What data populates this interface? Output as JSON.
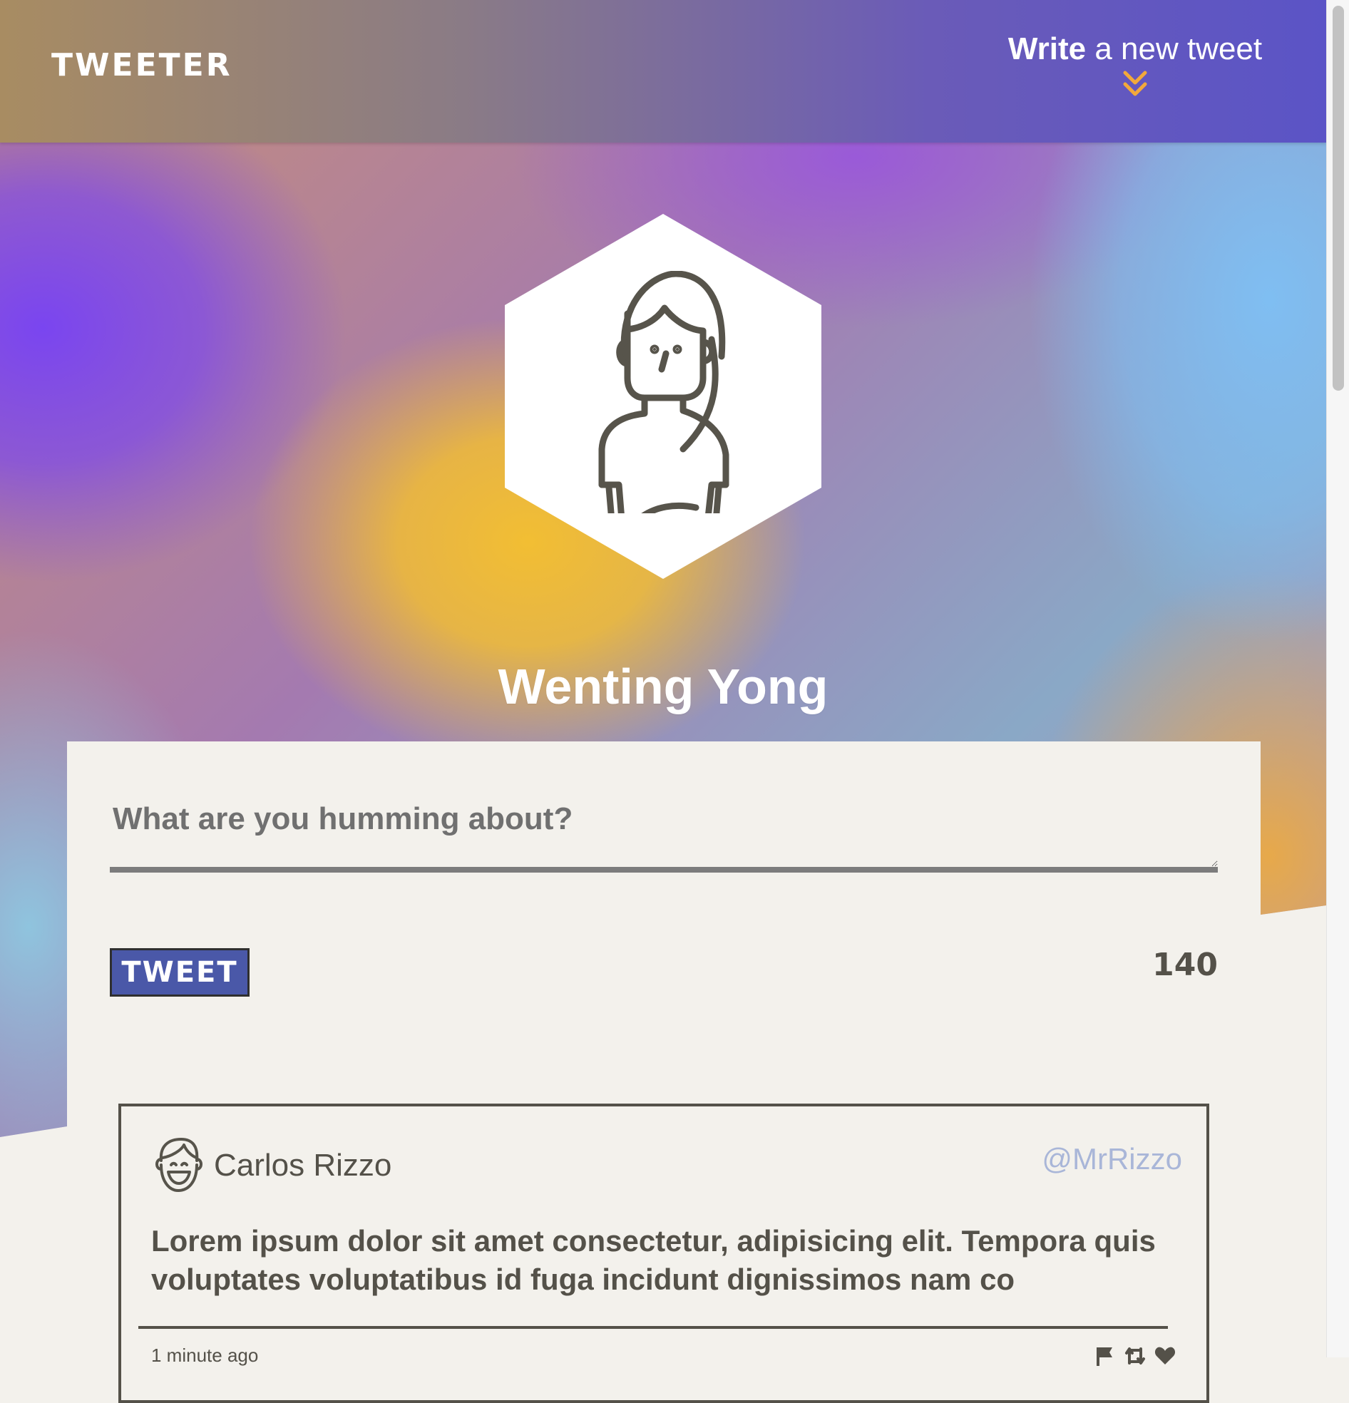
{
  "header": {
    "logo": "TWEETER",
    "compose_toggle": {
      "bold": "Write",
      "rest": " a new tweet",
      "icon": "double-chevron-down-icon"
    }
  },
  "profile": {
    "name": "Wenting Yong",
    "avatar_icon": "woman-avatar-icon"
  },
  "compose": {
    "placeholder": "What are you humming about?",
    "value": "",
    "button_label": "TWEET",
    "counter": "140"
  },
  "tweets": [
    {
      "name": "Carlos Rizzo",
      "handle": "@MrRizzo",
      "avatar_icon": "man-avatar-icon",
      "body": "Lorem ipsum dolor sit amet consectetur, adipisicing elit. Tempora quis voluptates voluptatibus id fuga incidunt dignissimos nam co",
      "time": "1 minute ago",
      "actions": [
        "flag-icon",
        "retweet-icon",
        "heart-icon"
      ]
    }
  ],
  "colors": {
    "accent": "#f2a93b",
    "tweet_button": "#4a58a8",
    "text_dark": "#545149",
    "handle": "#a9b6d8",
    "page_bg": "#f3f1ec"
  }
}
